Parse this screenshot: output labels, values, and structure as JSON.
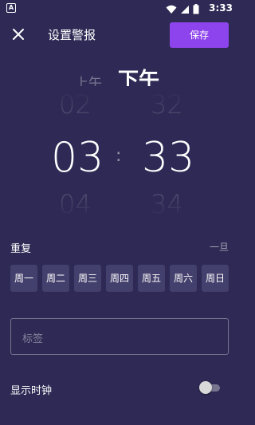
{
  "status_bar": {
    "time": "3:33",
    "notification_letter": "A"
  },
  "header": {
    "title": "设置警报",
    "save_label": "保存"
  },
  "picker": {
    "am_label": "上午",
    "pm_label": "下午",
    "selected_period": "下午",
    "hour_prev": "02",
    "hour_current": "03",
    "hour_next": "04",
    "minute_prev": "32",
    "minute_current": "33",
    "minute_next": "34",
    "separator": ":"
  },
  "repeat": {
    "label": "重复",
    "summary": "一旦",
    "days": [
      "周一",
      "周二",
      "周三",
      "周四",
      "周五",
      "周六",
      "周日"
    ]
  },
  "label_input": {
    "placeholder": "标签",
    "value": ""
  },
  "show_clock": {
    "label": "显示时钟",
    "enabled": false
  },
  "colors": {
    "background": "#2e2a55",
    "accent": "#8e44ec",
    "day_chip": "#44406d"
  }
}
